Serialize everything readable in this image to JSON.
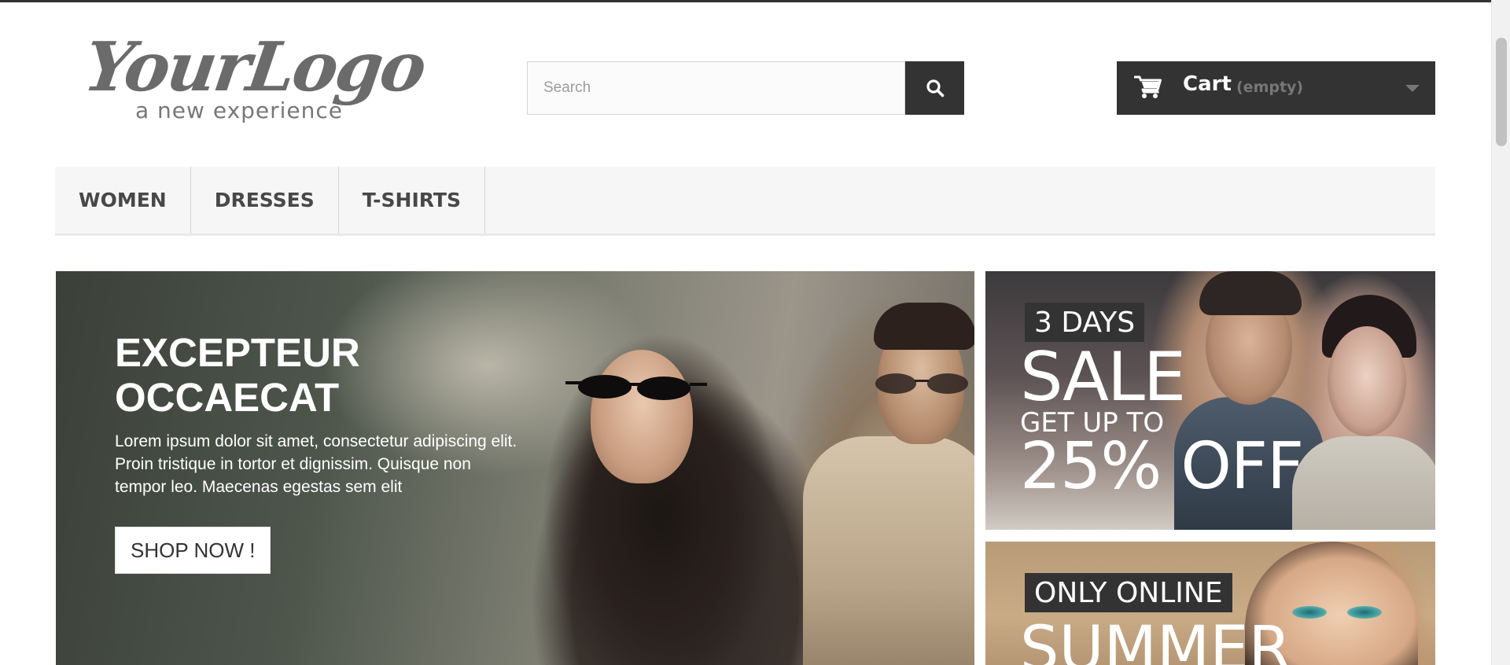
{
  "header": {
    "logo": {
      "main": "YourLogo",
      "tagline": "a new experience"
    },
    "search": {
      "placeholder": "Search",
      "value": "",
      "button_icon": "search-icon"
    },
    "cart": {
      "label": "Cart",
      "status": "(empty)",
      "icon": "cart-icon"
    }
  },
  "nav": {
    "items": [
      {
        "label": "WOMEN"
      },
      {
        "label": "DRESSES"
      },
      {
        "label": "T-SHIRTS"
      }
    ]
  },
  "slider": {
    "title": "EXCEPTEUR OCCAECAT",
    "text": "Lorem ipsum dolor sit amet, consectetur adipiscing elit. Proin tristique in tortor et dignissim. Quisque non tempor leo. Maecenas egestas sem elit",
    "button_label": "SHOP NOW !"
  },
  "banners": [
    {
      "tag": "3 DAYS",
      "line1": "SALE",
      "line2": "GET UP TO",
      "line3": "25% OFF"
    },
    {
      "tag": "ONLY ONLINE",
      "line1": "SUMMER"
    }
  ],
  "colors": {
    "dark": "#333333",
    "nav_bg": "#f6f6f6",
    "cart_status": "#777777"
  }
}
